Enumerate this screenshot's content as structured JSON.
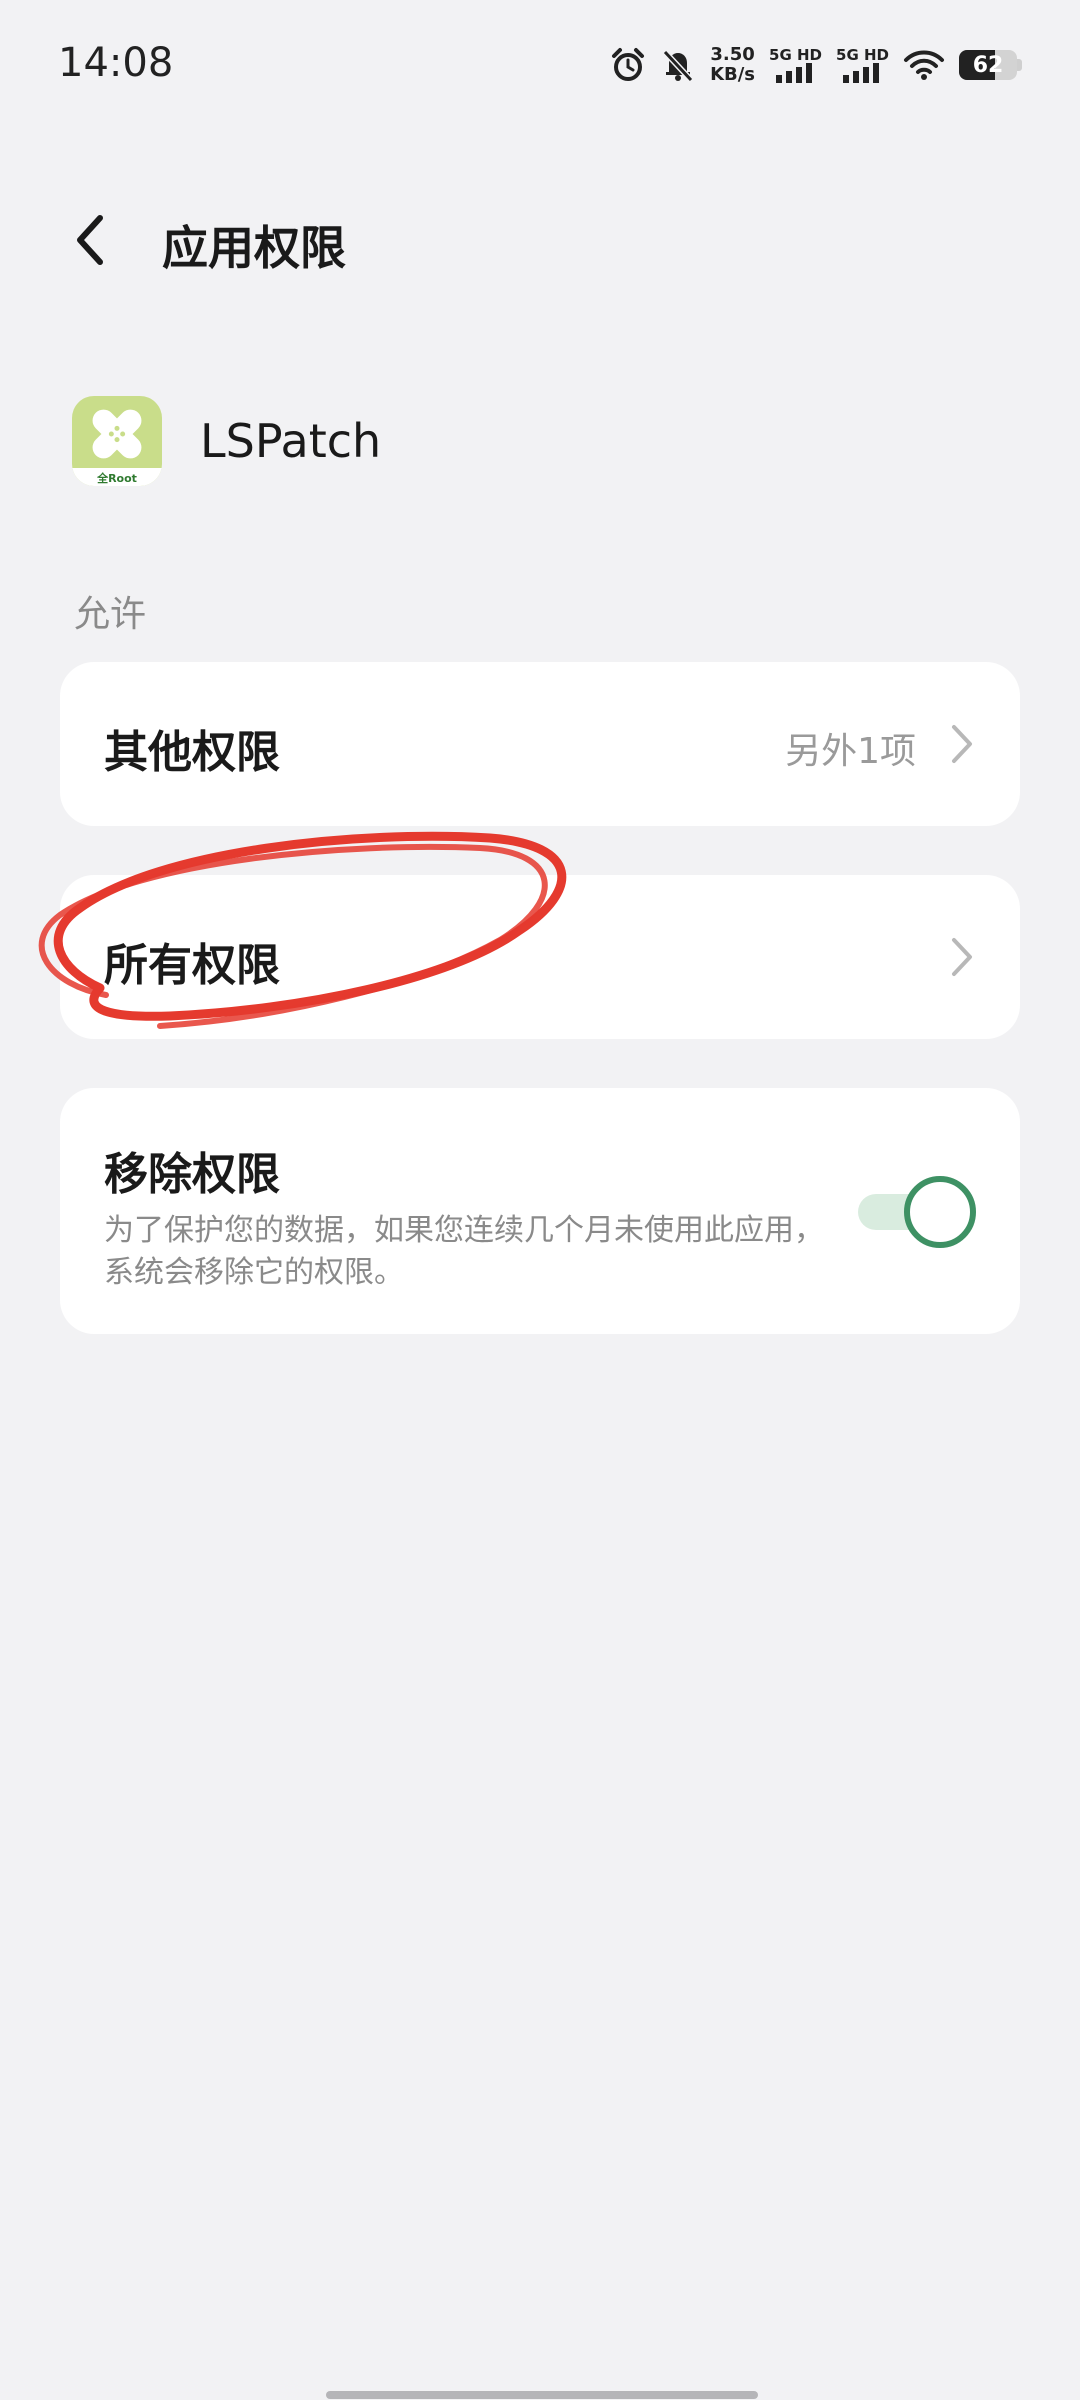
{
  "status_bar": {
    "time": "14:08",
    "net_speed_value": "3.50",
    "net_speed_unit": "KB/s",
    "sim1_label": "5G HD",
    "sim2_label": "5G HD",
    "battery_level": "62",
    "icons": [
      "alarm-icon",
      "bell-muted-icon",
      "signal-icon",
      "wifi-icon",
      "battery-icon"
    ]
  },
  "nav": {
    "title": "应用权限",
    "back_icon": "chevron-left-icon"
  },
  "app": {
    "name": "LSPatch",
    "icon_label": "全Root",
    "icon_colors": {
      "top": "#c9dd8a",
      "bottom": "#ffffff",
      "label": "#2f7a2f"
    }
  },
  "section": {
    "label": "允许"
  },
  "items": [
    {
      "title": "其他权限",
      "value": "另外1项"
    },
    {
      "title": "所有权限",
      "value": ""
    }
  ],
  "remove_permissions": {
    "title": "移除权限",
    "description": "为了保护您的数据，如果您连续几个月未使用此应用，系统会移除它的权限。",
    "enabled": true,
    "accent": "#3e9164"
  },
  "annotation_color": "#e53a2e"
}
